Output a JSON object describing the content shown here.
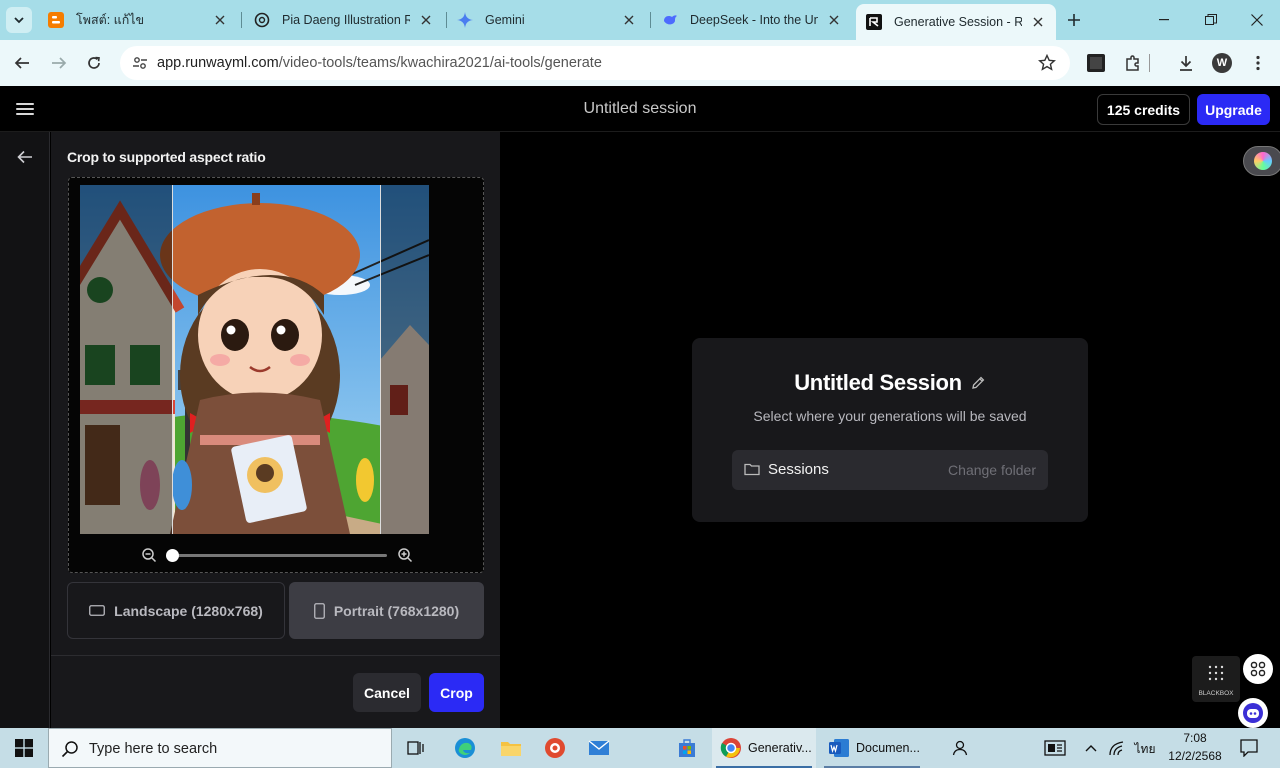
{
  "browser": {
    "tabs": [
      {
        "title": "โพสต์: แก้ไข",
        "favicon": "blogger-icon"
      },
      {
        "title": "Pia Daeng Illustration Re",
        "favicon": "chatgpt-icon"
      },
      {
        "title": "Gemini",
        "favicon": "gemini-icon"
      },
      {
        "title": "DeepSeek - Into the Unkn",
        "favicon": "deepseek-icon"
      },
      {
        "title": "Generative Session - Run",
        "favicon": "runway-icon",
        "active": true
      }
    ],
    "url_host": "app.runwayml.com",
    "url_path": "/video-tools/teams/kwachira2021/ai-tools/generate",
    "profile_initial": "W"
  },
  "app": {
    "session_title": "Untitled session",
    "credits_label": "125 credits",
    "upgrade_label": "Upgrade"
  },
  "crop": {
    "title": "Crop to supported aspect ratio",
    "zoom_level": 0,
    "landscape_label": "Landscape (1280x768)",
    "portrait_label": "Portrait (768x1280)",
    "selected_ratio": "portrait",
    "cancel_label": "Cancel",
    "crop_label": "Crop"
  },
  "session_card": {
    "title": "Untitled Session",
    "subtitle": "Select where your generations will be saved",
    "folder_label": "Sessions",
    "change_folder_label": "Change folder"
  },
  "widgets": {
    "blackbox_label": "BLACKBOX"
  },
  "taskbar": {
    "search_placeholder": "Type here to search",
    "apps": [
      {
        "label": "Generativ...",
        "icon": "chrome-icon",
        "active": true
      },
      {
        "label": "Documen...",
        "icon": "word-icon",
        "active": false
      }
    ],
    "language": "ไทย",
    "time": "7:08",
    "date": "12/2/2568"
  },
  "colors": {
    "accent": "#2b2af5",
    "tab_strip": "#a6dde8",
    "panel": "#18181b"
  }
}
